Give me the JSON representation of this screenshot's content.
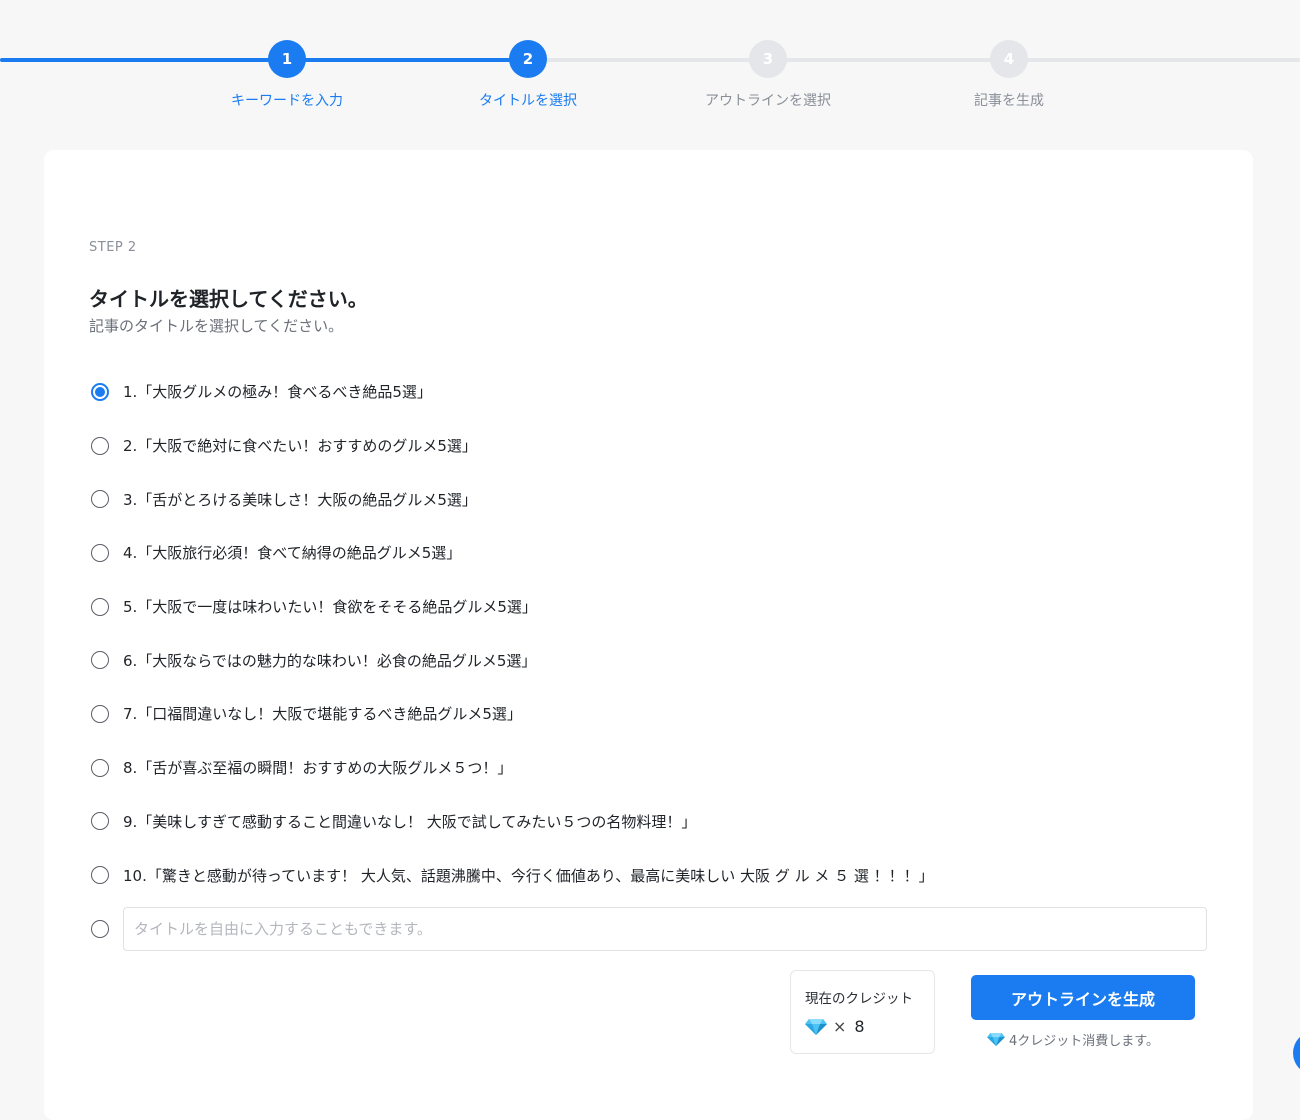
{
  "stepper": {
    "steps": [
      {
        "number": "1",
        "label": "キーワードを入力"
      },
      {
        "number": "2",
        "label": "タイトルを選択"
      },
      {
        "number": "3",
        "label": "アウトラインを選択"
      },
      {
        "number": "4",
        "label": "記事を生成"
      }
    ],
    "current_step": 2
  },
  "card": {
    "step_label": "STEP 2",
    "title": "タイトルを選択してください。",
    "subtitle": "記事のタイトルを選択してください。"
  },
  "titles": [
    "1.「大阪グルメの極み！食べるべき絶品5選」",
    "2.「大阪で絶対に食べたい！おすすめのグルメ5選」",
    "3.「舌がとろける美味しさ！大阪の絶品グルメ5選」",
    "4.「大阪旅行必須！食べて納得の絶品グルメ5選」",
    "5.「大阪で一度は味わいたい！食欲をそそる絶品グルメ5選」",
    "6.「大阪ならではの魅力的な味わい！必食の絶品グルメ5選」",
    "7.「口福間違いなし！大阪で堪能するべき絶品グルメ5選」",
    "8.「舌が喜ぶ至福の瞬間！おすすめの大阪グルメ５つ！」",
    "9.「美味しすぎて感動すること間違いなし！ 大阪で試してみたい５つの名物料理！」",
    "10.「驚きと感動が待っています！ 大人気、話題沸騰中、今行く価値あり、最高に美味しい 大阪 グ ル メ ５ 選 ！！！」"
  ],
  "selected_index": 0,
  "custom_title": {
    "value": "",
    "placeholder": "タイトルを自由に入力することもできます。"
  },
  "credit": {
    "label": "現在のクレジット",
    "multiplier": "×",
    "amount": "8",
    "icon": "diamond-icon"
  },
  "actions": {
    "generate_label": "アウトラインを生成",
    "cost_note": "4クレジット消費します。"
  },
  "colors": {
    "accent": "#1a7cf0",
    "inactive": "#e5e6ea",
    "gem": "#4cc3f5"
  }
}
